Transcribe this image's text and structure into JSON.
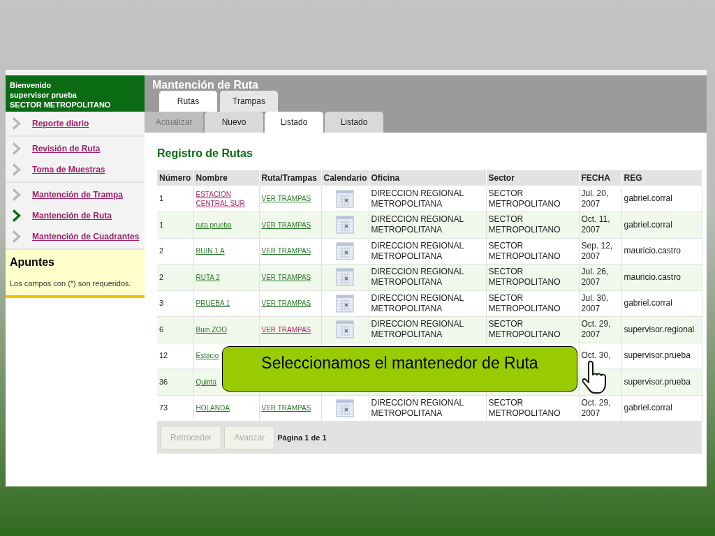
{
  "sidebar": {
    "welcome": [
      "Bienvenido",
      "supervisor prueba",
      "SECTOR METROPOLITANO"
    ],
    "groups": [
      {
        "items": [
          {
            "label": "Reporte diario",
            "selected": false
          }
        ]
      },
      {
        "items": [
          {
            "label": "Revisión de Ruta",
            "selected": false
          },
          {
            "label": "Toma de Muestras",
            "selected": false
          }
        ]
      },
      {
        "items": [
          {
            "label": "Mantención de Trampa",
            "selected": false
          },
          {
            "label": "Mantención de Ruta",
            "selected": true
          },
          {
            "label": "Mantención de Cuadrantes",
            "selected": false
          }
        ]
      }
    ],
    "notes": {
      "title": "Apuntes",
      "text": "Los campos con (*) son requeridos."
    }
  },
  "main": {
    "title": "Mantención de Ruta",
    "tabs": [
      {
        "label": "Rutas",
        "selected": true
      },
      {
        "label": "Trampas",
        "selected": false
      }
    ],
    "subtabs": [
      {
        "label": "Actualizar",
        "selected": false,
        "disabled": true
      },
      {
        "label": "Nuevo",
        "selected": false,
        "disabled": false
      },
      {
        "label": "Listado",
        "selected": true,
        "disabled": false
      },
      {
        "label": "Listado",
        "selected": false,
        "disabled": false
      }
    ]
  },
  "table": {
    "title": "Registro de Rutas",
    "columns": [
      "Número",
      "Nombre",
      "Ruta/Trampas",
      "Calendario",
      "Oficina",
      "Sector",
      "FECHA",
      "REG"
    ],
    "rows": [
      {
        "numero": "1",
        "nombre": "ESTACION CENTRAL SUR",
        "nombre_visited": true,
        "ruta": "VER TRAMPAS",
        "ruta_visited": false,
        "calendar": true,
        "oficina": "DIRECCION REGIONAL METROPOLITANA",
        "sector": "SECTOR METROPOLITANO",
        "fecha": "Jul. 20, 2007",
        "reg": "gabriel.corral"
      },
      {
        "numero": "1",
        "nombre": "ruta prueba",
        "nombre_visited": false,
        "ruta": "VER TRAMPAS",
        "ruta_visited": false,
        "calendar": true,
        "oficina": "DIRECCION REGIONAL METROPOLITANA",
        "sector": "SECTOR METROPOLITANO",
        "fecha": "Oct. 11, 2007",
        "reg": "gabriel.corral"
      },
      {
        "numero": "2",
        "nombre": "BUIN 1 A",
        "nombre_visited": false,
        "ruta": "VER TRAMPAS",
        "ruta_visited": false,
        "calendar": true,
        "oficina": "DIRECCION REGIONAL METROPOLITANA",
        "sector": "SECTOR METROPOLITANO",
        "fecha": "Sep. 12, 2007",
        "reg": "mauricio.castro"
      },
      {
        "numero": "2",
        "nombre": "RUTA 2",
        "nombre_visited": false,
        "ruta": "VER TRAMPAS",
        "ruta_visited": false,
        "calendar": true,
        "oficina": "DIRECCION REGIONAL METROPOLITANA",
        "sector": "SECTOR METROPOLITANO",
        "fecha": "Jul. 26, 2007",
        "reg": "mauricio.castro"
      },
      {
        "numero": "3",
        "nombre": "PRUEBA 1",
        "nombre_visited": false,
        "ruta": "VER TRAMPAS",
        "ruta_visited": false,
        "calendar": true,
        "oficina": "DIRECCION REGIONAL METROPOLITANA",
        "sector": "SECTOR METROPOLITANO",
        "fecha": "Jul. 30, 2007",
        "reg": "gabriel.corral"
      },
      {
        "numero": "6",
        "nombre": "Buin ZOO",
        "nombre_visited": false,
        "ruta": "VER TRAMPAS",
        "ruta_visited": true,
        "calendar": true,
        "oficina": "DIRECCION REGIONAL METROPOLITANA",
        "sector": "SECTOR METROPOLITANO",
        "fecha": "Oct. 29, 2007",
        "reg": "supervisor.regional"
      },
      {
        "numero": "12",
        "nombre": "Estacio",
        "nombre_visited": false,
        "fecha": "Oct. 30,",
        "reg": "supervisor.prueba"
      },
      {
        "numero": "36",
        "nombre": "Quinta",
        "nombre_visited": false,
        "reg": "supervisor.prueba"
      },
      {
        "numero": "73",
        "nombre": "HOLANDA",
        "nombre_visited": false,
        "ruta": "VER TRAMPAS",
        "ruta_visited": false,
        "calendar": true,
        "oficina": "DIRECCION REGIONAL METROPOLITANA",
        "sector": "SECTOR METROPOLITANO",
        "fecha": "Oct. 29, 2007",
        "reg": "gabriel.corral"
      }
    ]
  },
  "pager": {
    "buttons": [
      {
        "label": "Retroceder",
        "disabled": true
      },
      {
        "label": "Avanzar",
        "disabled": true
      }
    ],
    "text": "Página 1 de 1"
  },
  "callout": {
    "text": "Seleccionamos el mantenedor de Ruta"
  }
}
